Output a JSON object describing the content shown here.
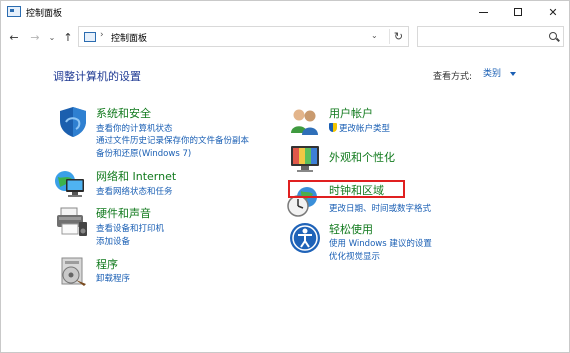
{
  "window": {
    "title": "控制面板"
  },
  "address": {
    "path": "控制面板",
    "search_placeholder": ""
  },
  "header": {
    "title": "调整计算机的设置",
    "view_by_label": "查看方式:",
    "view_by_value": "类别"
  },
  "categories_left": [
    {
      "title": "系统和安全",
      "icon": "shield-icon",
      "links": [
        "查看你的计算机状态",
        "通过文件历史记录保存你的文件备份副本",
        "备份和还原(Windows 7)"
      ]
    },
    {
      "title": "网络和 Internet",
      "icon": "network-icon",
      "links": [
        "查看网络状态和任务"
      ]
    },
    {
      "title": "硬件和声音",
      "icon": "printer-icon",
      "links": [
        "查看设备和打印机",
        "添加设备"
      ]
    },
    {
      "title": "程序",
      "icon": "programs-icon",
      "links": [
        "卸载程序"
      ]
    }
  ],
  "categories_right": [
    {
      "title": "用户帐户",
      "icon": "users-icon",
      "links": [
        "更改帐户类型"
      ]
    },
    {
      "title": "外观和个性化",
      "icon": "monitor-icon",
      "links": []
    },
    {
      "title": "时钟和区域",
      "icon": "clock-globe-icon",
      "links": [
        "更改日期、时间或数字格式"
      ]
    },
    {
      "title": "轻松使用",
      "icon": "ease-of-access-icon",
      "links": [
        "使用 Windows 建议的设置",
        "优化视觉显示"
      ]
    }
  ],
  "colors": {
    "category_title": "#117a1d",
    "link": "#1a5fb4",
    "highlight": "#e02020"
  }
}
